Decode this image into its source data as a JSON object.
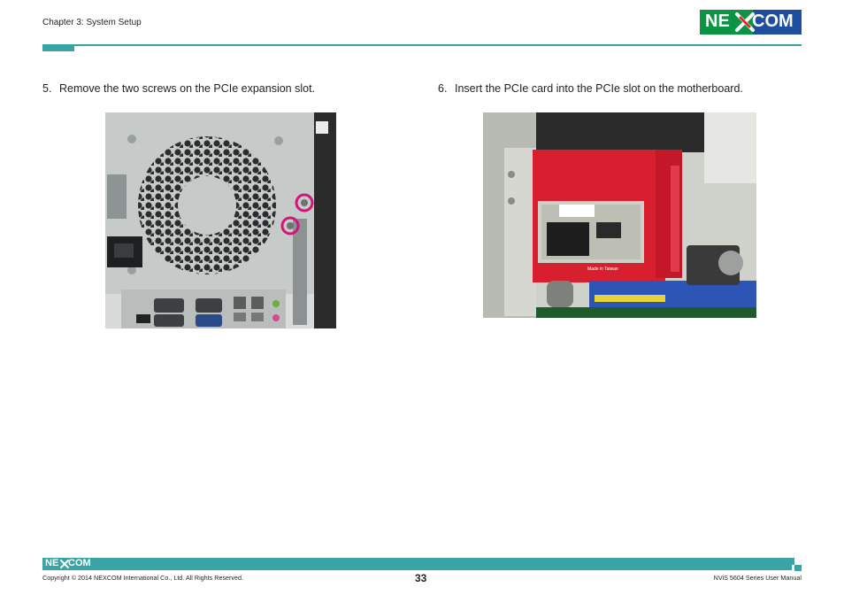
{
  "header": {
    "chapter": "Chapter 3: System Setup",
    "logo_text_left": "NE",
    "logo_text_right": "COM",
    "logo_colors": {
      "green": "#0b9444",
      "blue": "#1e4e9d",
      "red": "#e3242b"
    },
    "accent_color": "#3aa3a5"
  },
  "steps": [
    {
      "number": "5.",
      "text": "Remove the two screws on the PCIe expansion slot."
    },
    {
      "number": "6.",
      "text": "Insert the PCIe card into the PCIe slot on the motherboard."
    }
  ],
  "photos": {
    "rear_panel_icon": "pc-rear-panel-photo",
    "pcie_card_icon": "pcie-card-photo",
    "card_label": "Made in Taiwan"
  },
  "footer": {
    "logo_text_left": "NE",
    "logo_text_right": "COM",
    "copyright": "Copyright © 2014 NEXCOM International Co., Ltd. All Rights Reserved.",
    "page_number": "33",
    "manual_title": "NViS 5604 Series User Manual"
  }
}
